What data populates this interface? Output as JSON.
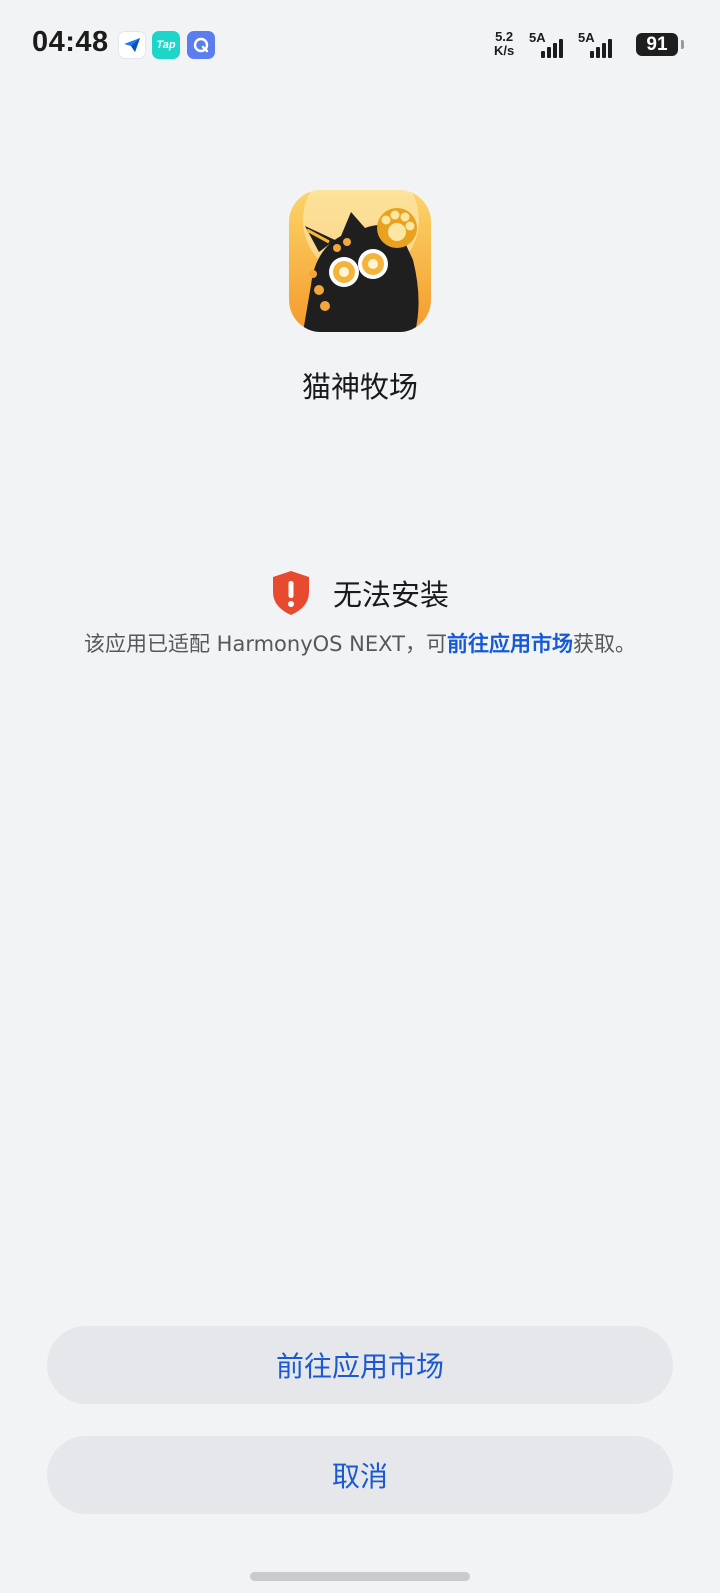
{
  "status_bar": {
    "time": "04:48",
    "network_speed_value": "5.2",
    "network_speed_unit": "K/s",
    "sim1_label": "5A",
    "sim2_label": "5A",
    "battery_level": "91"
  },
  "notifications": [
    {
      "icon": "paper-plane-icon"
    },
    {
      "icon": "taptap-icon",
      "label": "Tap"
    },
    {
      "icon": "browser-icon"
    }
  ],
  "app": {
    "name": "猫神牧场",
    "icon": "cat-app-icon"
  },
  "warning": {
    "title": "无法安装",
    "description_prefix": "该应用已适配 HarmonyOS NEXT，可",
    "description_link": "前往应用市场",
    "description_suffix": "获取。",
    "icon": "shield-alert-icon",
    "color": "#e84a2f"
  },
  "buttons": {
    "market_label": "前往应用市场",
    "cancel_label": "取消"
  },
  "colors": {
    "accent": "#1559d9",
    "background": "#f1f3f5",
    "button_bg": "#e5e7ea"
  }
}
